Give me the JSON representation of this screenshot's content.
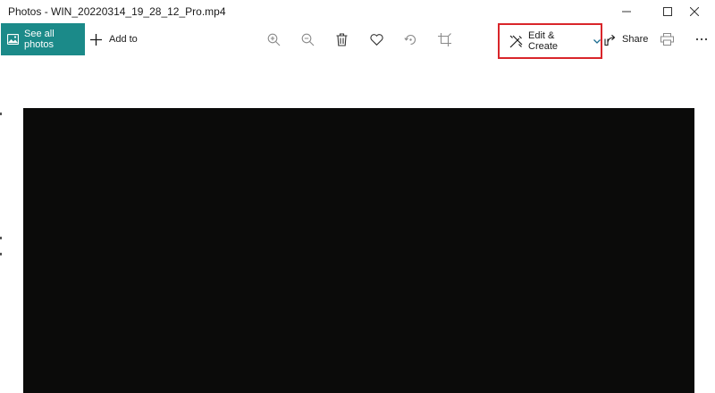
{
  "window": {
    "title": "Photos - WIN_20220314_19_28_12_Pro.mp4"
  },
  "toolbar": {
    "see_all_photos": "See all photos",
    "add_to": "Add to",
    "edit_create": "Edit & Create",
    "share": "Share"
  },
  "colors": {
    "accent": "#1b8a89",
    "highlight_border": "#d9252a",
    "video_background": "#0b0b0a"
  },
  "icons": [
    "photos-icon",
    "plus-icon",
    "zoom-in-icon",
    "zoom-out-icon",
    "trash-icon",
    "heart-icon",
    "rotate-icon",
    "crop-icon",
    "edit-create-icon",
    "chevron-down-icon",
    "share-icon",
    "print-icon",
    "more-icon"
  ]
}
